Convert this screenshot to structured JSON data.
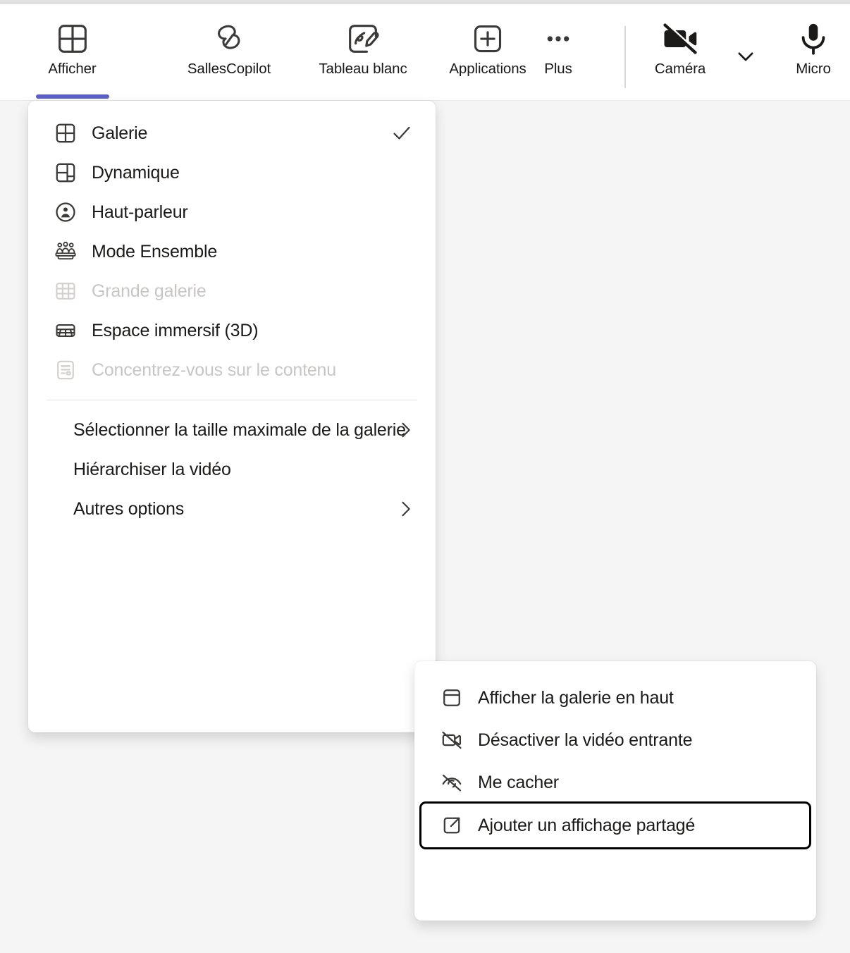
{
  "toolbar": {
    "items": [
      {
        "label": "Afficher",
        "icon": "grid-view-icon",
        "active": true
      },
      {
        "label": "SallesCopilot",
        "icon": "copilot-icon",
        "active": false
      },
      {
        "label": "Tableau blanc",
        "icon": "whiteboard-icon",
        "active": false
      },
      {
        "label": "Applications",
        "icon": "plus-square-icon",
        "active": false
      },
      {
        "label": "Plus",
        "icon": "more-horizontal-icon",
        "active": false
      },
      {
        "label": "Caméra",
        "icon": "camera-off-icon",
        "active": false
      },
      {
        "label": "Micro",
        "icon": "microphone-icon",
        "active": false
      }
    ],
    "camera_chevron_icon": "chevron-down-icon",
    "accent_color": "#5b5fc7"
  },
  "view_menu": {
    "items": [
      {
        "label": "Galerie",
        "icon": "grid-view-icon",
        "checked": true,
        "disabled": false,
        "submenu": false
      },
      {
        "label": "Dynamique",
        "icon": "dynamic-view-icon",
        "checked": false,
        "disabled": false,
        "submenu": false
      },
      {
        "label": "Haut-parleur",
        "icon": "speaker-person-icon",
        "checked": false,
        "disabled": false,
        "submenu": false
      },
      {
        "label": "Mode Ensemble",
        "icon": "together-mode-icon",
        "checked": false,
        "disabled": false,
        "submenu": false
      },
      {
        "label": "Grande galerie",
        "icon": "large-gallery-icon",
        "checked": false,
        "disabled": true,
        "submenu": false
      },
      {
        "label": "Espace immersif (3D)",
        "icon": "immersive-space-icon",
        "checked": false,
        "disabled": false,
        "submenu": false
      },
      {
        "label": "Concentrez-vous sur le contenu",
        "icon": "focus-content-icon",
        "checked": false,
        "disabled": true,
        "submenu": false
      }
    ],
    "bottom_items": [
      {
        "label": "Sélectionner la taille maximale de la galerie",
        "submenu": true
      },
      {
        "label": "Hiérarchiser la vidéo",
        "submenu": false
      },
      {
        "label": "Autres options",
        "submenu": true
      }
    ],
    "checkmark_icon": "checkmark-icon",
    "submenu_icon": "chevron-right-icon"
  },
  "sub_menu": {
    "items": [
      {
        "label": "Afficher la galerie en haut",
        "icon": "gallery-top-icon",
        "focused": false
      },
      {
        "label": "Désactiver la vidéo entrante",
        "icon": "video-off-icon",
        "focused": false
      },
      {
        "label": "Me cacher",
        "icon": "eye-off-icon",
        "focused": false
      },
      {
        "label": "Ajouter un affichage partagé",
        "icon": "external-link-icon",
        "focused": true
      }
    ]
  }
}
